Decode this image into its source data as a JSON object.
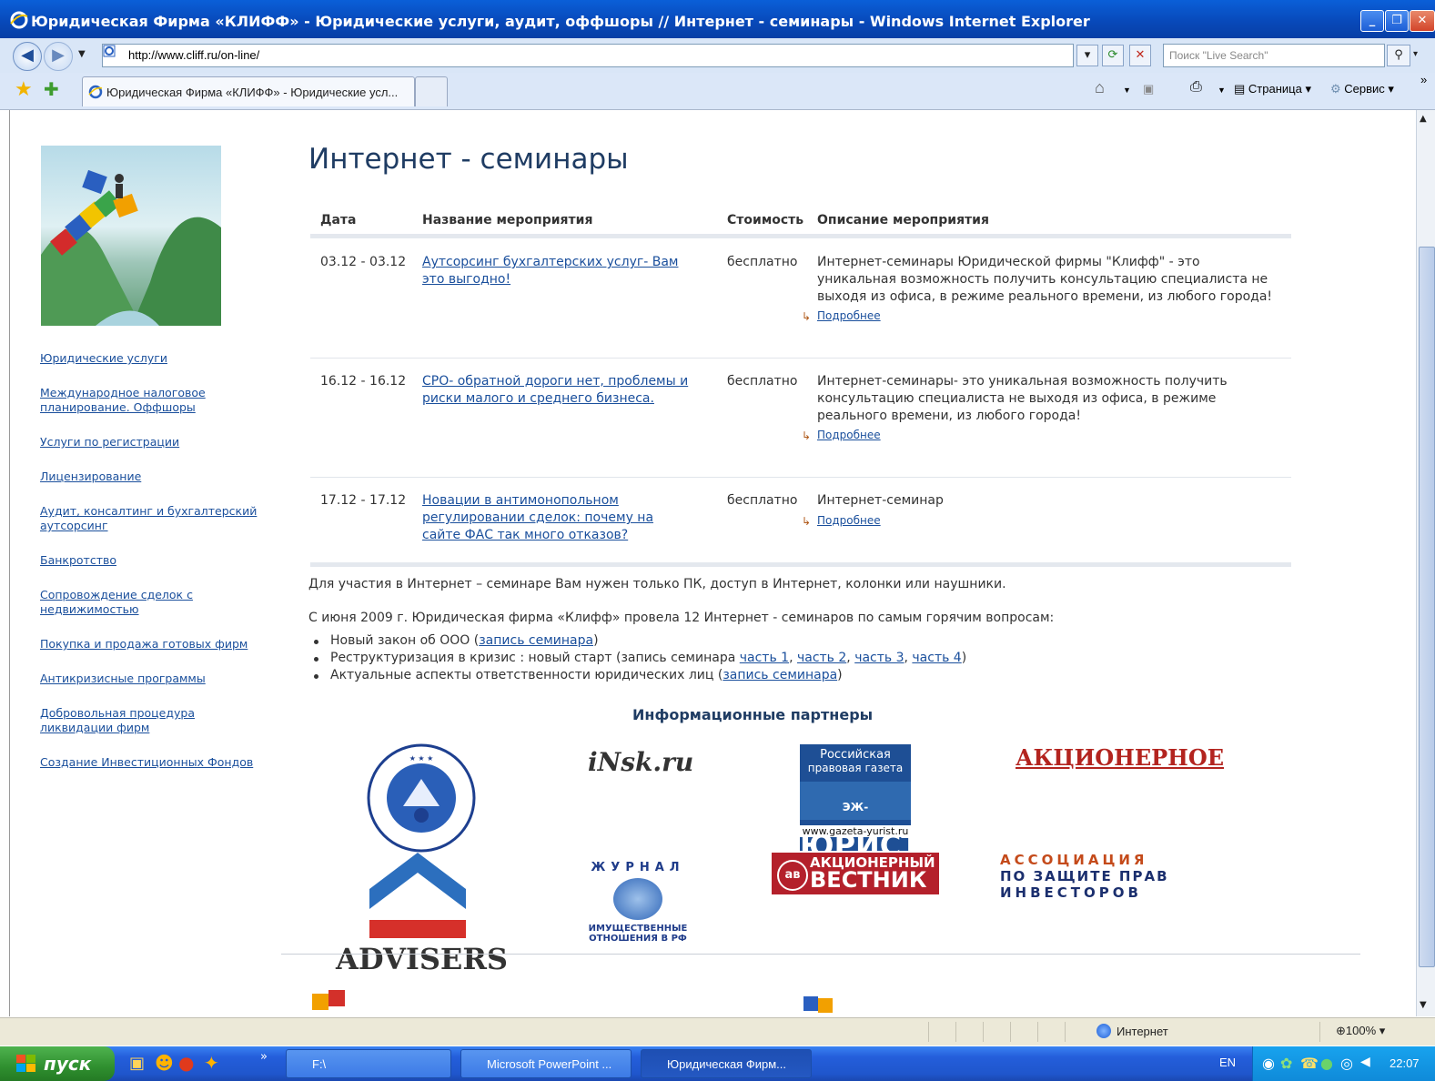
{
  "window": {
    "title": "Юридическая Фирма «КЛИФФ» - Юридические услуги, аудит, оффшоры // Интернет - семинары - Windows Internet Explorer"
  },
  "addressbar": {
    "url": "http://www.cliff.ru/on-line/",
    "search_placeholder": "Поиск \"Live Search\""
  },
  "tabs": [
    {
      "label": "Юридическая Фирма «КЛИФФ» - Юридические усл..."
    }
  ],
  "commandbar": {
    "page_label": "Страница",
    "tools_label": "Сервис"
  },
  "sidebar": {
    "items": [
      {
        "label": "Юридические услуги"
      },
      {
        "label": "Международное налоговое планирование. Оффшоры"
      },
      {
        "label": "Услуги по регистрации"
      },
      {
        "label": "Лицензирование"
      },
      {
        "label": "Аудит, консалтинг и бухгалтерский аутсорсинг"
      },
      {
        "label": "Банкротство"
      },
      {
        "label": "Сопровождение сделок с недвижимостью"
      },
      {
        "label": "Покупка и продажа готовых фирм"
      },
      {
        "label": "Антикризисные программы"
      },
      {
        "label": "Добровольная процедура ликвидации фирм"
      },
      {
        "label": "Создание Инвестиционных Фондов"
      }
    ]
  },
  "main": {
    "title": "Интернет - семинары",
    "table": {
      "headers": [
        "Дата",
        "Название мероприятия",
        "Стоимость",
        "Описание мероприятия"
      ],
      "rows": [
        {
          "date": "03.12 - 03.12",
          "name": "Аутсорсинг бухгалтерских услуг- Вам это выгодно!",
          "cost": "бесплатно",
          "description": "Интернет-семинары Юридической фирмы \"Клифф\" - это уникальная возможность получить консультацию специалиста не выходя из офиса, в режиме реального времени, из любого города!",
          "more": "Подробнее"
        },
        {
          "date": "16.12 - 16.12",
          "name": "СРО- обратной дороги нет, проблемы и риски малого и среднего бизнеса.",
          "cost": "бесплатно",
          "description": "Интернет-семинары- это уникальная возможность получить консультацию специалиста не выходя из офиса, в режиме реального времени, из любого города!",
          "more": "Подробнее"
        },
        {
          "date": "17.12 - 17.12",
          "name": "Новации в антимонопольном регулировании сделок: почему на сайте ФАС так много отказов?",
          "cost": "бесплатно",
          "description": "Интернет-семинар",
          "more": "Подробнее"
        }
      ]
    },
    "para1": "Для участия в Интернет – семинаре Вам нужен только ПК, доступ в Интернет, колонки или наушники.",
    "para2": "С июня 2009 г. Юридическая фирма «Клифф» провела 12 Интернет - семинаров по самым горячим вопросам:",
    "bullets": {
      "b1_text": "Новый закон об ООО (",
      "b1_link": "запись семинара",
      "b1_end": ")",
      "b2_text": "Реструктуризация в кризис : новый старт (запись семинара ",
      "b2_link1": "часть 1",
      "b2_link2": "часть 2",
      "b2_link3": "часть 3",
      "b2_link4": "часть 4",
      "b2_sep": ", ",
      "b2_end": ")",
      "b3_text": "Актуальные аспекты ответственности юридических лиц (",
      "b3_link": "запись семинара",
      "b3_end": ")"
    },
    "partners": {
      "title": "Информационные партнеры",
      "logos": {
        "rpg_line1": "Российская",
        "rpg_line2": "правовая газета",
        "yurist_prefix": "ЭЖ-",
        "yurist": "ЮРИСТ",
        "yurist_url": "www.gazeta-yurist.ru",
        "nsk": "iNsk.ru",
        "aktsionernoe": "АКЦИОНЕРНОЕ",
        "vestnik_top": "АКЦИОНЕРНЫЙ",
        "vestnik": "ВЕСТНИК",
        "assoc_1": "АССОЦИАЦИЯ",
        "assoc_2": "ПО ЗАЩИТЕ ПРАВ",
        "assoc_3": "ИНВЕСТОРОВ",
        "journal": "ЖУРНАЛ",
        "journal_2": "ИМУЩЕСТВЕННЫЕ",
        "journal_3": "ОТНОШЕНИЯ В РФ",
        "advisers": "ADVISERS"
      }
    }
  },
  "statusbar": {
    "zone": "Интернет",
    "zoom": "100%"
  },
  "taskbar": {
    "start": "пуск",
    "items": [
      {
        "label": "F:\\"
      },
      {
        "label": "Microsoft PowerPoint ..."
      },
      {
        "label": "Юридическая Фирм..."
      }
    ],
    "lang": "EN",
    "clock": "22:07"
  },
  "colors": {
    "link": "#1a4f9c",
    "title_blue": "#0848b8",
    "taskbar_blue": "#245edb",
    "start_green": "#2f8f2f"
  }
}
